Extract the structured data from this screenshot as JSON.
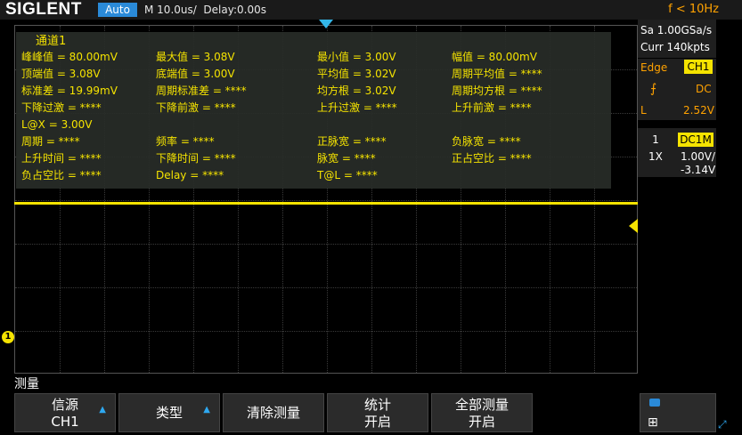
{
  "topbar": {
    "brand": "SIGLENT",
    "mode": "Auto",
    "timebase": "M 10.0us/  Delay:0.00s",
    "trigger_freq": "f < 10Hz"
  },
  "right_panel": {
    "sample_rate": "Sa 1.00GSa/s",
    "curr_pts": "Curr 140kpts",
    "trigger_type": "Edge",
    "trigger_source": "CH1",
    "coupling": "DC",
    "level_label": "L",
    "level_value": "2.52V",
    "channel_number": "1",
    "channel_coupling": "DC1M",
    "probe": "1X",
    "vdiv": "1.00V/",
    "offset": "-3.14V"
  },
  "measurements": {
    "title": "通道1",
    "items": [
      "峰峰值 = 80.00mV",
      "最大值 = 3.08V",
      "最小值 = 3.00V",
      "幅值 = 80.00mV",
      "顶端值 = 3.08V",
      "底端值 = 3.00V",
      "平均值 = 3.02V",
      "周期平均值 = ****",
      "标准差 = 19.99mV",
      "周期标准差 = ****",
      "均方根 = 3.02V",
      "周期均方根 = ****",
      "下降过激 = ****",
      "下降前激 = ****",
      "上升过激 = ****",
      "上升前激 = ****",
      "L@X = 3.00V",
      "",
      "",
      "",
      "周期 = ****",
      "频率 = ****",
      "正脉宽 = ****",
      "负脉宽 = ****",
      "上升时间 = ****",
      "下降时间 = ****",
      "脉宽 = ****",
      "正占空比 = ****",
      "负占空比 = ****",
      "Delay = ****",
      "T@L = ****",
      ""
    ]
  },
  "channel_marker": "1",
  "menu": {
    "title": "测量",
    "source_label": "信源",
    "source_value": "CH1",
    "type_label": "类型",
    "clear_label": "清除测量",
    "stats_label": "统计",
    "stats_value": "开启",
    "all_label": "全部测量",
    "all_value": "开启"
  },
  "colors": {
    "channel1": "#f5e300",
    "accent_blue": "#2a8ad8",
    "trigger_orange": "#ffa200"
  }
}
